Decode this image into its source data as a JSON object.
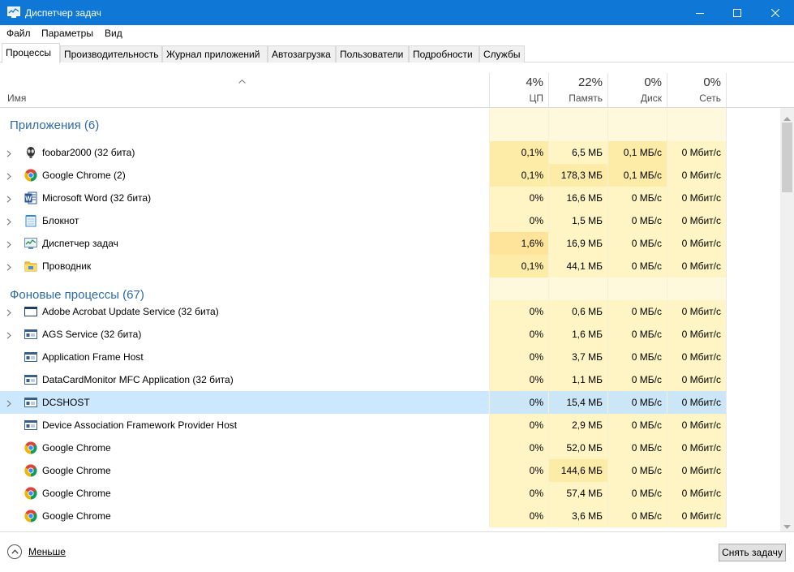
{
  "window": {
    "title": "Диспетчер задач",
    "accent": "#0f78d7"
  },
  "menu": [
    "Файл",
    "Параметры",
    "Вид"
  ],
  "tabs": [
    "Процессы",
    "Производительность",
    "Журнал приложений",
    "Автозагрузка",
    "Пользователи",
    "Подробности",
    "Службы"
  ],
  "columns": {
    "name": "Имя",
    "cpu": {
      "pct": "4%",
      "label": "ЦП"
    },
    "mem": {
      "pct": "22%",
      "label": "Память"
    },
    "disk": {
      "pct": "0%",
      "label": "Диск"
    },
    "net": {
      "pct": "0%",
      "label": "Сеть"
    }
  },
  "groups": {
    "apps": "Приложения (6)",
    "background": "Фоновые процессы (67)"
  },
  "apps": [
    {
      "name": "foobar2000 (32 бита)",
      "icon": "foobar-icon",
      "expandable": true,
      "cpu": "0,1%",
      "mem": "6,5 МБ",
      "disk": "0,1 МБ/с",
      "net": "0 Мбит/с"
    },
    {
      "name": "Google Chrome (2)",
      "icon": "chrome-icon",
      "expandable": true,
      "cpu": "0,1%",
      "mem": "178,3 МБ",
      "disk": "0,1 МБ/с",
      "net": "0 Мбит/с"
    },
    {
      "name": "Microsoft Word (32 бита)",
      "icon": "word-icon",
      "expandable": true,
      "cpu": "0%",
      "mem": "16,6 МБ",
      "disk": "0 МБ/с",
      "net": "0 Мбит/с"
    },
    {
      "name": "Блокнот",
      "icon": "notepad-icon",
      "expandable": true,
      "cpu": "0%",
      "mem": "1,5 МБ",
      "disk": "0 МБ/с",
      "net": "0 Мбит/с"
    },
    {
      "name": "Диспетчер задач",
      "icon": "taskmgr-icon",
      "expandable": true,
      "cpu": "1,6%",
      "mem": "16,9 МБ",
      "disk": "0 МБ/с",
      "net": "0 Мбит/с"
    },
    {
      "name": "Проводник",
      "icon": "explorer-icon",
      "expandable": true,
      "cpu": "0,1%",
      "mem": "44,1 МБ",
      "disk": "0 МБ/с",
      "net": "0 Мбит/с"
    }
  ],
  "background": [
    {
      "name": "Adobe Acrobat Update Service (32 бита)",
      "icon": "service-window-icon",
      "expandable": true,
      "cpu": "0%",
      "mem": "0,6 МБ",
      "disk": "0 МБ/с",
      "net": "0 Мбит/с"
    },
    {
      "name": "AGS Service (32 бита)",
      "icon": "service-app-icon",
      "expandable": true,
      "cpu": "0%",
      "mem": "1,6 МБ",
      "disk": "0 МБ/с",
      "net": "0 Мбит/с"
    },
    {
      "name": "Application Frame Host",
      "icon": "service-app-icon",
      "expandable": false,
      "cpu": "0%",
      "mem": "3,7 МБ",
      "disk": "0 МБ/с",
      "net": "0 Мбит/с"
    },
    {
      "name": "DataCardMonitor MFC Application (32 бита)",
      "icon": "service-app-icon",
      "expandable": false,
      "cpu": "0%",
      "mem": "1,1 МБ",
      "disk": "0 МБ/с",
      "net": "0 Мбит/с"
    },
    {
      "name": "DCSHOST",
      "icon": "service-app-icon",
      "expandable": true,
      "selected": true,
      "cpu": "0%",
      "mem": "15,4 МБ",
      "disk": "0 МБ/с",
      "net": "0 Мбит/с"
    },
    {
      "name": "Device Association Framework Provider Host",
      "icon": "service-app-icon",
      "expandable": false,
      "cpu": "0%",
      "mem": "2,9 МБ",
      "disk": "0 МБ/с",
      "net": "0 Мбит/с"
    },
    {
      "name": "Google Chrome",
      "icon": "chrome-icon",
      "expandable": false,
      "cpu": "0%",
      "mem": "52,0 МБ",
      "disk": "0 МБ/с",
      "net": "0 Мбит/с"
    },
    {
      "name": "Google Chrome",
      "icon": "chrome-icon",
      "expandable": false,
      "cpu": "0%",
      "mem": "144,6 МБ",
      "disk": "0 МБ/с",
      "net": "0 Мбит/с"
    },
    {
      "name": "Google Chrome",
      "icon": "chrome-icon",
      "expandable": false,
      "cpu": "0%",
      "mem": "57,4 МБ",
      "disk": "0 МБ/с",
      "net": "0 Мбит/с"
    },
    {
      "name": "Google Chrome",
      "icon": "chrome-icon",
      "expandable": false,
      "cpu": "0%",
      "mem": "3,6 МБ",
      "disk": "0 МБ/с",
      "net": "0 Мбит/с"
    }
  ],
  "footer": {
    "fewer_label": "Меньше",
    "end_task_label": "Снять задачу"
  },
  "heat_colors": {
    "light": "#fff4c4",
    "lighter": "#fef8dc",
    "medium": "#fdeba8",
    "strong": "#fde49a"
  }
}
